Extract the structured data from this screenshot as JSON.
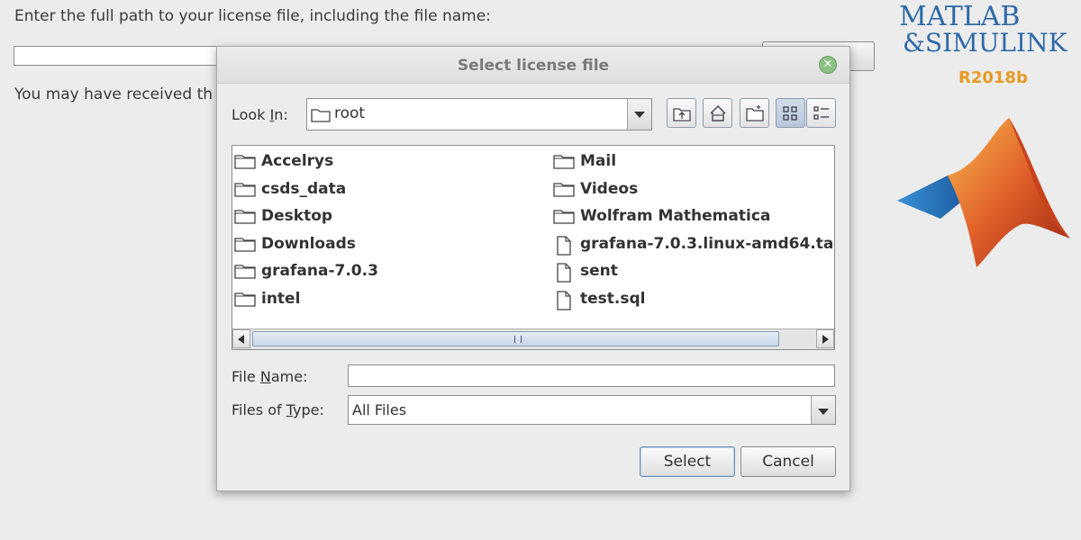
{
  "background": {
    "instruction": "Enter the full path to your license file, including the file name:",
    "note": "You may have received th"
  },
  "brand": {
    "matlab": "MATLAB",
    "simulink": "&SIMULINK",
    "release": "R2018b"
  },
  "dialog": {
    "title": "Select license file",
    "look_in_label_pre": "Look ",
    "look_in_label_mnemonic": "I",
    "look_in_label_post": "n:",
    "look_in_value": "root",
    "toolbar_icons": [
      "up-folder-icon",
      "home-icon",
      "new-folder-icon",
      "list-view-icon",
      "details-view-icon"
    ],
    "files": [
      {
        "name": "Accelrys",
        "type": "folder"
      },
      {
        "name": "csds_data",
        "type": "folder"
      },
      {
        "name": "Desktop",
        "type": "folder"
      },
      {
        "name": "Downloads",
        "type": "folder"
      },
      {
        "name": "grafana-7.0.3",
        "type": "folder"
      },
      {
        "name": "intel",
        "type": "folder"
      },
      {
        "name": "Mail",
        "type": "folder"
      },
      {
        "name": "Videos",
        "type": "folder"
      },
      {
        "name": "Wolfram Mathematica",
        "type": "folder"
      },
      {
        "name": "grafana-7.0.3.linux-amd64.ta",
        "type": "file"
      },
      {
        "name": "sent",
        "type": "file"
      },
      {
        "name": "test.sql",
        "type": "file"
      }
    ],
    "file_name_label_pre": "File ",
    "file_name_label_mnemonic": "N",
    "file_name_label_post": "ame:",
    "file_name_value": "",
    "file_type_label_pre": "Files of ",
    "file_type_label_mnemonic": "T",
    "file_type_label_post": "ype:",
    "file_type_value": "All Files",
    "select_button": "Select",
    "cancel_button": "Cancel"
  }
}
